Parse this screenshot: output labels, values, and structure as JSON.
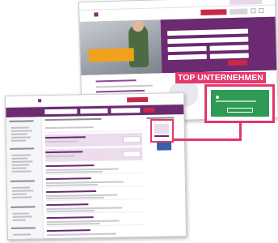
{
  "badge": {
    "label": "TOP UNTERNEHMEN"
  }
}
